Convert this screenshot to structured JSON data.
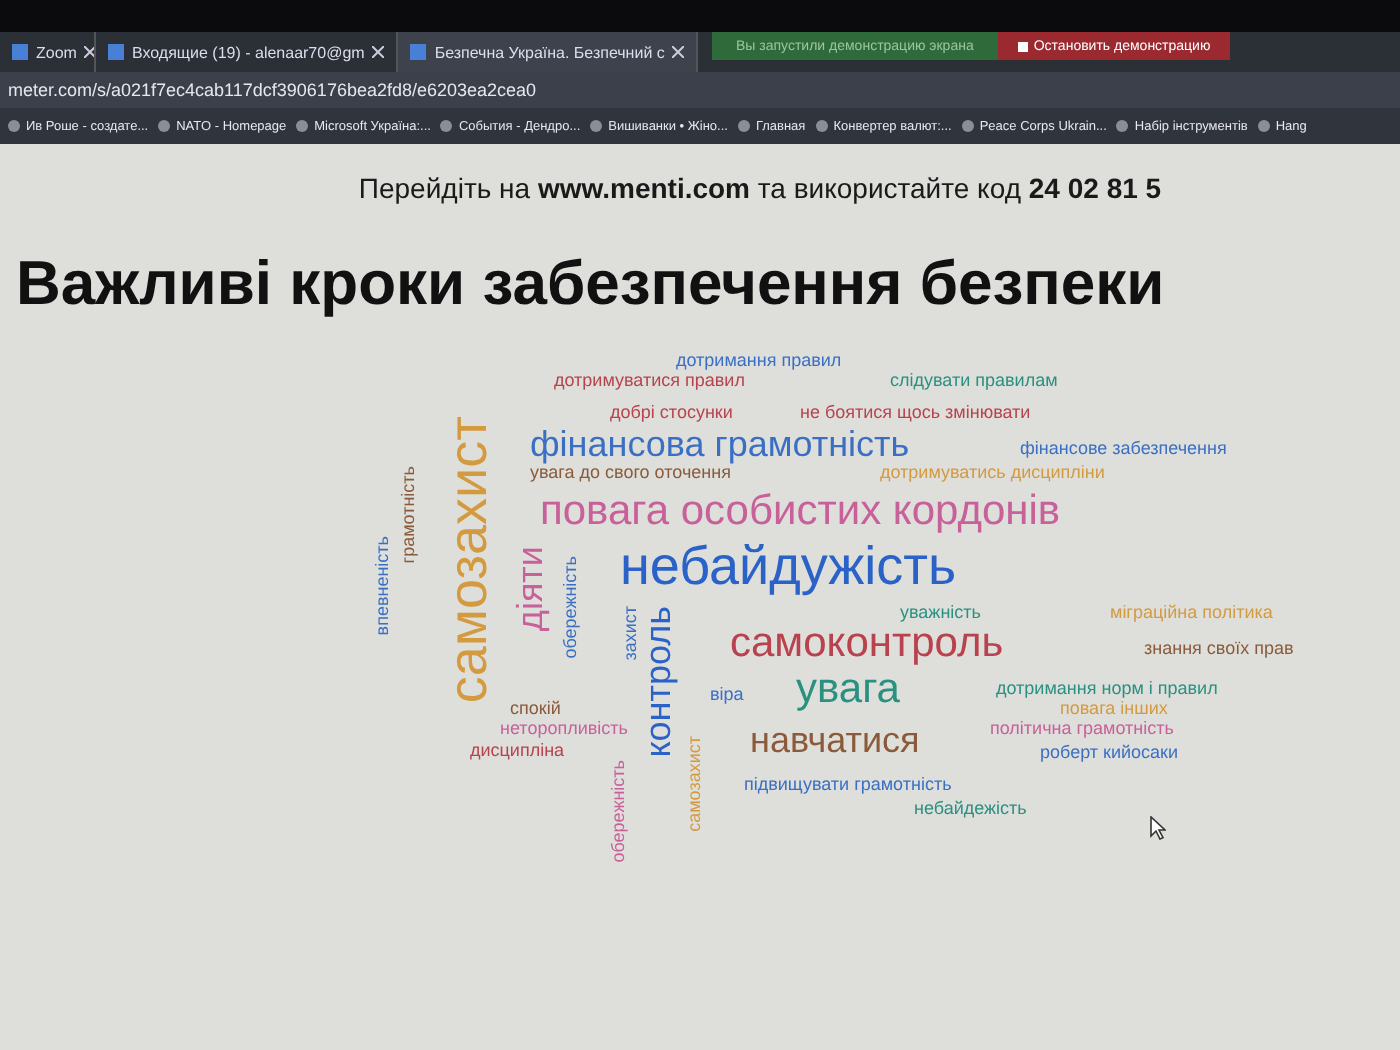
{
  "browser": {
    "tabs": [
      {
        "label": "Zoom",
        "selected": false
      },
      {
        "label": "Входящие (19) - alenaar70@gm",
        "selected": false
      },
      {
        "label": "Безпечна Україна. Безпечний с",
        "selected": true
      }
    ],
    "share_banner": {
      "message": "Вы запустили демонстрацию экрана",
      "stop_button": "Остановить демонстрацию"
    },
    "address": "meter.com/s/a021f7ec4cab117dcf3906176bea2fd8/e6203ea2cea0",
    "bookmarks": [
      "Ив Роше - создате...",
      "NATO - Homepage",
      "Microsoft Україна:...",
      "События - Дендро...",
      "Вишиванки • Жіно...",
      "Главная",
      "Конвертер валют:...",
      "Peace Corps Ukrain...",
      "Набір інструментів",
      "Hang"
    ]
  },
  "slide": {
    "instructions": "Перейдіть на **www.menti.com** та використайте код **24 02 81 5**",
    "title": "Важливі кроки забезпечення безпеки",
    "words": [
      {
        "text": "дотримання правил",
        "color": "#3a6fc4"
      },
      {
        "text": "дотримуватися правил",
        "color": "#b8424e"
      },
      {
        "text": "слідувати правилам",
        "color": "#2a9080"
      },
      {
        "text": "добрі стосунки",
        "color": "#b8424e"
      },
      {
        "text": "не боятися щось змінювати",
        "color": "#b8424e"
      },
      {
        "text": "самозахист",
        "color": "#d49a40"
      },
      {
        "text": "фінансова грамотність",
        "color": "#3a6fc4"
      },
      {
        "text": "фінансове забезпечення",
        "color": "#3a6fc4"
      },
      {
        "text": "увага до свого оточення",
        "color": "#8a5a3a"
      },
      {
        "text": "дотримуватись дисципліни",
        "color": "#d49a40"
      },
      {
        "text": "грамотність",
        "color": "#8a5a3a"
      },
      {
        "text": "повага особистих кордонів",
        "color": "#c8609a"
      },
      {
        "text": "впевненість",
        "color": "#3a6fc4"
      },
      {
        "text": "діяти",
        "color": "#c8609a"
      },
      {
        "text": "обережність",
        "color": "#3a6fc4"
      },
      {
        "text": "небайдужість",
        "color": "#2a62c8"
      },
      {
        "text": "уважність",
        "color": "#2a9080"
      },
      {
        "text": "міграційна політика",
        "color": "#d49a40"
      },
      {
        "text": "захист",
        "color": "#3a6fc4"
      },
      {
        "text": "контроль",
        "color": "#2a62c8"
      },
      {
        "text": "самоконтроль",
        "color": "#b8424e"
      },
      {
        "text": "знання своїх прав",
        "color": "#8a5a3a"
      },
      {
        "text": "віра",
        "color": "#3a6fc4"
      },
      {
        "text": "увага",
        "color": "#2a9080"
      },
      {
        "text": "дотримання норм і правил",
        "color": "#2a9080"
      },
      {
        "text": "спокій",
        "color": "#8a5a3a"
      },
      {
        "text": "повага інших",
        "color": "#d49a40"
      },
      {
        "text": "неторопливість",
        "color": "#c8609a"
      },
      {
        "text": "навчатися",
        "color": "#8a5a3a"
      },
      {
        "text": "політична грамотність",
        "color": "#c8609a"
      },
      {
        "text": "самозахист",
        "color": "#d49a40"
      },
      {
        "text": "дисципліна",
        "color": "#b8424e"
      },
      {
        "text": "роберт кийосаки",
        "color": "#3a6fc4"
      },
      {
        "text": "обережність",
        "color": "#c8609a"
      },
      {
        "text": "підвищувати грамотність",
        "color": "#3a6fc4"
      },
      {
        "text": "небайдежість",
        "color": "#2a9080"
      }
    ]
  }
}
